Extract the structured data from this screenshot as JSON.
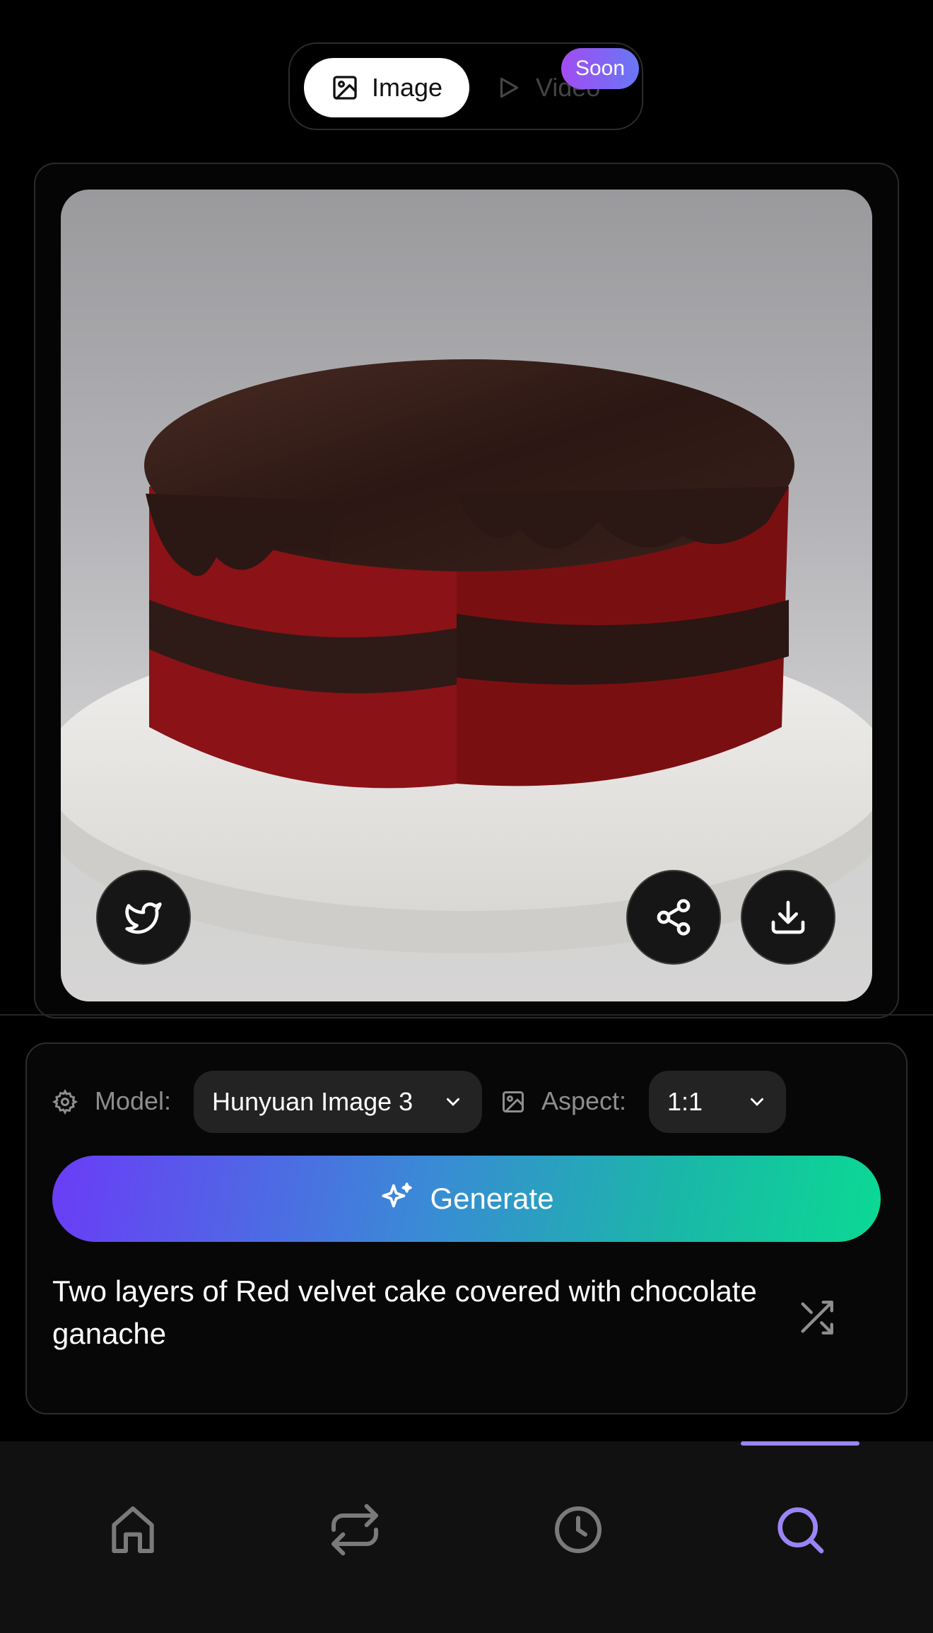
{
  "mode_toggle": {
    "image_label": "Image",
    "video_label": "Video",
    "soon_badge": "Soon",
    "selected": "Image"
  },
  "image": {
    "description_icon": "generated-image",
    "actions": {
      "twitter_icon": "twitter-icon",
      "share_icon": "share-icon",
      "download_icon": "download-icon"
    }
  },
  "controls": {
    "model_label": "Model:",
    "model_value": "Hunyuan Image 3",
    "aspect_label": "Aspect:",
    "aspect_value": "1:1",
    "generate_label": "Generate",
    "prompt": "Two layers of Red velvet cake covered with chocolate ganache"
  },
  "nav": {
    "items": [
      "home-icon",
      "swap-icon",
      "history-icon",
      "search-icon"
    ],
    "active": "search-icon",
    "active_color": "#9b85f4"
  },
  "colors": {
    "soon_gradient_start": "#a24cf2",
    "generate_start": "#6a3cf7",
    "generate_end": "#0bd993"
  }
}
